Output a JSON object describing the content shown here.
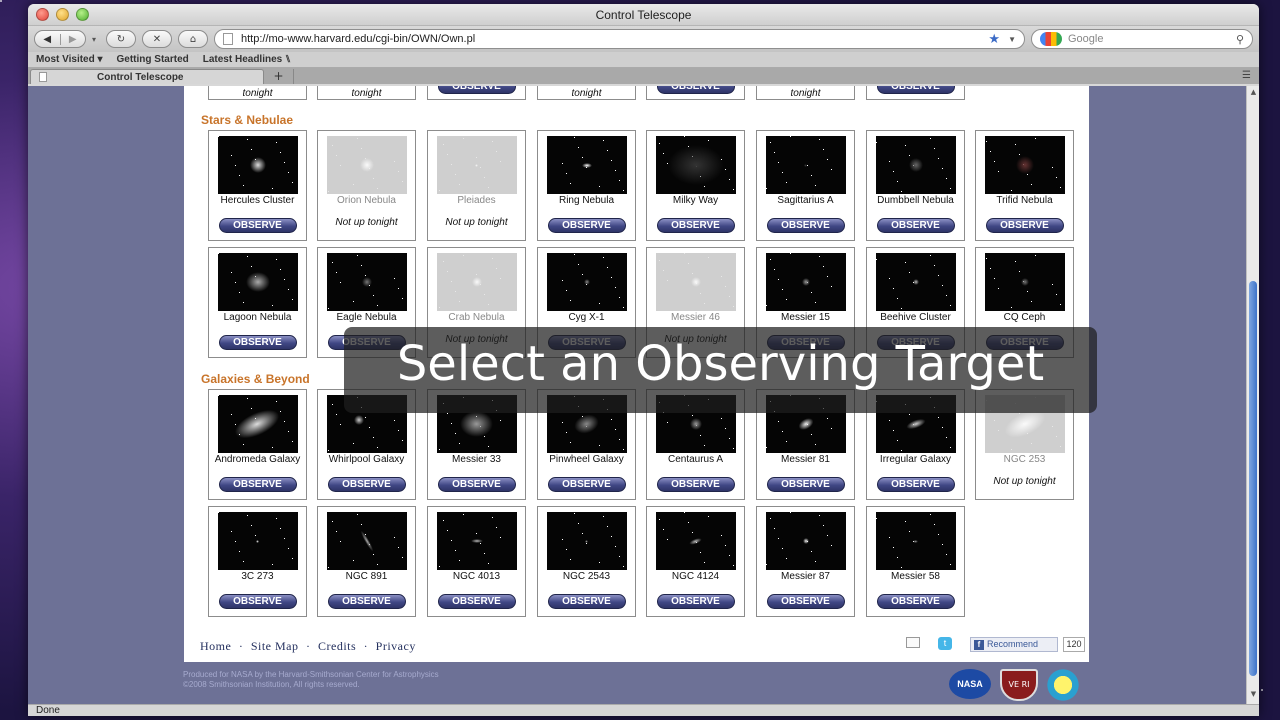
{
  "window": {
    "title": "Control Telescope"
  },
  "nav": {
    "url": "http://mo-www.harvard.edu/cgi-bin/OWN/Own.pl",
    "search_placeholder": "Google"
  },
  "bookmarks": [
    "Most Visited ▾",
    "Getting Started",
    "Latest Headlines ⑊"
  ],
  "tab": {
    "title": "Control Telescope",
    "new_tab": "+"
  },
  "status": "Done",
  "top_partial": [
    {
      "ntl": "tonight"
    },
    {
      "ntl": "tonight"
    },
    {
      "obs": "OBSERVE"
    },
    {
      "ntl": "tonight"
    },
    {
      "obs": "OBSERVE"
    },
    {
      "ntl": "tonight"
    },
    {
      "obs": "OBSERVE"
    }
  ],
  "sections": {
    "stars": "Stars & Nebulae",
    "galaxies": "Galaxies & Beyond"
  },
  "stars_row1": [
    {
      "name": "Hercules Cluster",
      "observe": "OBSERVE"
    },
    {
      "name": "Orion Nebula",
      "not_up": "Not up tonight"
    },
    {
      "name": "Pleiades",
      "not_up": "Not up tonight"
    },
    {
      "name": "Ring Nebula",
      "observe": "OBSERVE"
    },
    {
      "name": "Milky Way",
      "observe": "OBSERVE"
    },
    {
      "name": "Sagittarius A",
      "observe": "OBSERVE"
    },
    {
      "name": "Dumbbell Nebula",
      "observe": "OBSERVE"
    },
    {
      "name": "Trifid Nebula",
      "observe": "OBSERVE"
    }
  ],
  "stars_row2": [
    {
      "name": "Lagoon Nebula",
      "observe": "OBSERVE"
    },
    {
      "name": "Eagle Nebula",
      "observe": "OBSERVE"
    },
    {
      "name": "Crab Nebula",
      "not_up": "Not up tonight"
    },
    {
      "name": "Cyg X-1",
      "observe": "OBSERVE"
    },
    {
      "name": "Messier 46",
      "not_up": "Not up tonight"
    },
    {
      "name": "Messier 15",
      "observe": "OBSERVE"
    },
    {
      "name": "Beehive Cluster",
      "observe": "OBSERVE"
    },
    {
      "name": "CQ Ceph",
      "observe": "OBSERVE"
    }
  ],
  "gal_row1": [
    {
      "name": "Andromeda Galaxy",
      "observe": "OBSERVE"
    },
    {
      "name": "Whirlpool Galaxy",
      "observe": "OBSERVE"
    },
    {
      "name": "Messier 33",
      "observe": "OBSERVE"
    },
    {
      "name": "Pinwheel Galaxy",
      "observe": "OBSERVE"
    },
    {
      "name": "Centaurus A",
      "observe": "OBSERVE"
    },
    {
      "name": "Messier 81",
      "observe": "OBSERVE"
    },
    {
      "name": "Irregular Galaxy",
      "observe": "OBSERVE"
    },
    {
      "name": "NGC 253",
      "not_up": "Not up tonight"
    }
  ],
  "gal_row2": [
    {
      "name": "3C 273",
      "observe": "OBSERVE"
    },
    {
      "name": "NGC 891",
      "observe": "OBSERVE"
    },
    {
      "name": "NGC 4013",
      "observe": "OBSERVE"
    },
    {
      "name": "NGC 2543",
      "observe": "OBSERVE"
    },
    {
      "name": "NGC 4124",
      "observe": "OBSERVE"
    },
    {
      "name": "Messier 87",
      "observe": "OBSERVE"
    },
    {
      "name": "Messier 58",
      "observe": "OBSERVE"
    }
  ],
  "footer": {
    "links": [
      "Home",
      "Site Map",
      "Credits",
      "Privacy"
    ],
    "sep": "·",
    "recommend": "Recommend",
    "recommend_count": "120",
    "credit_line1": "Produced for NASA by the Harvard-Smithsonian Center for Astrophysics",
    "credit_line2": "©2008 Smithsonian Institution, All rights reserved.",
    "nasa_logo": "NASA",
    "harvard_logo": "VE RI TAS"
  },
  "overlay_caption": "Select an Observing Target",
  "colors": {
    "section_title": "#c8742a",
    "observe_button": "#404785",
    "page_bg": "#6d7196"
  }
}
